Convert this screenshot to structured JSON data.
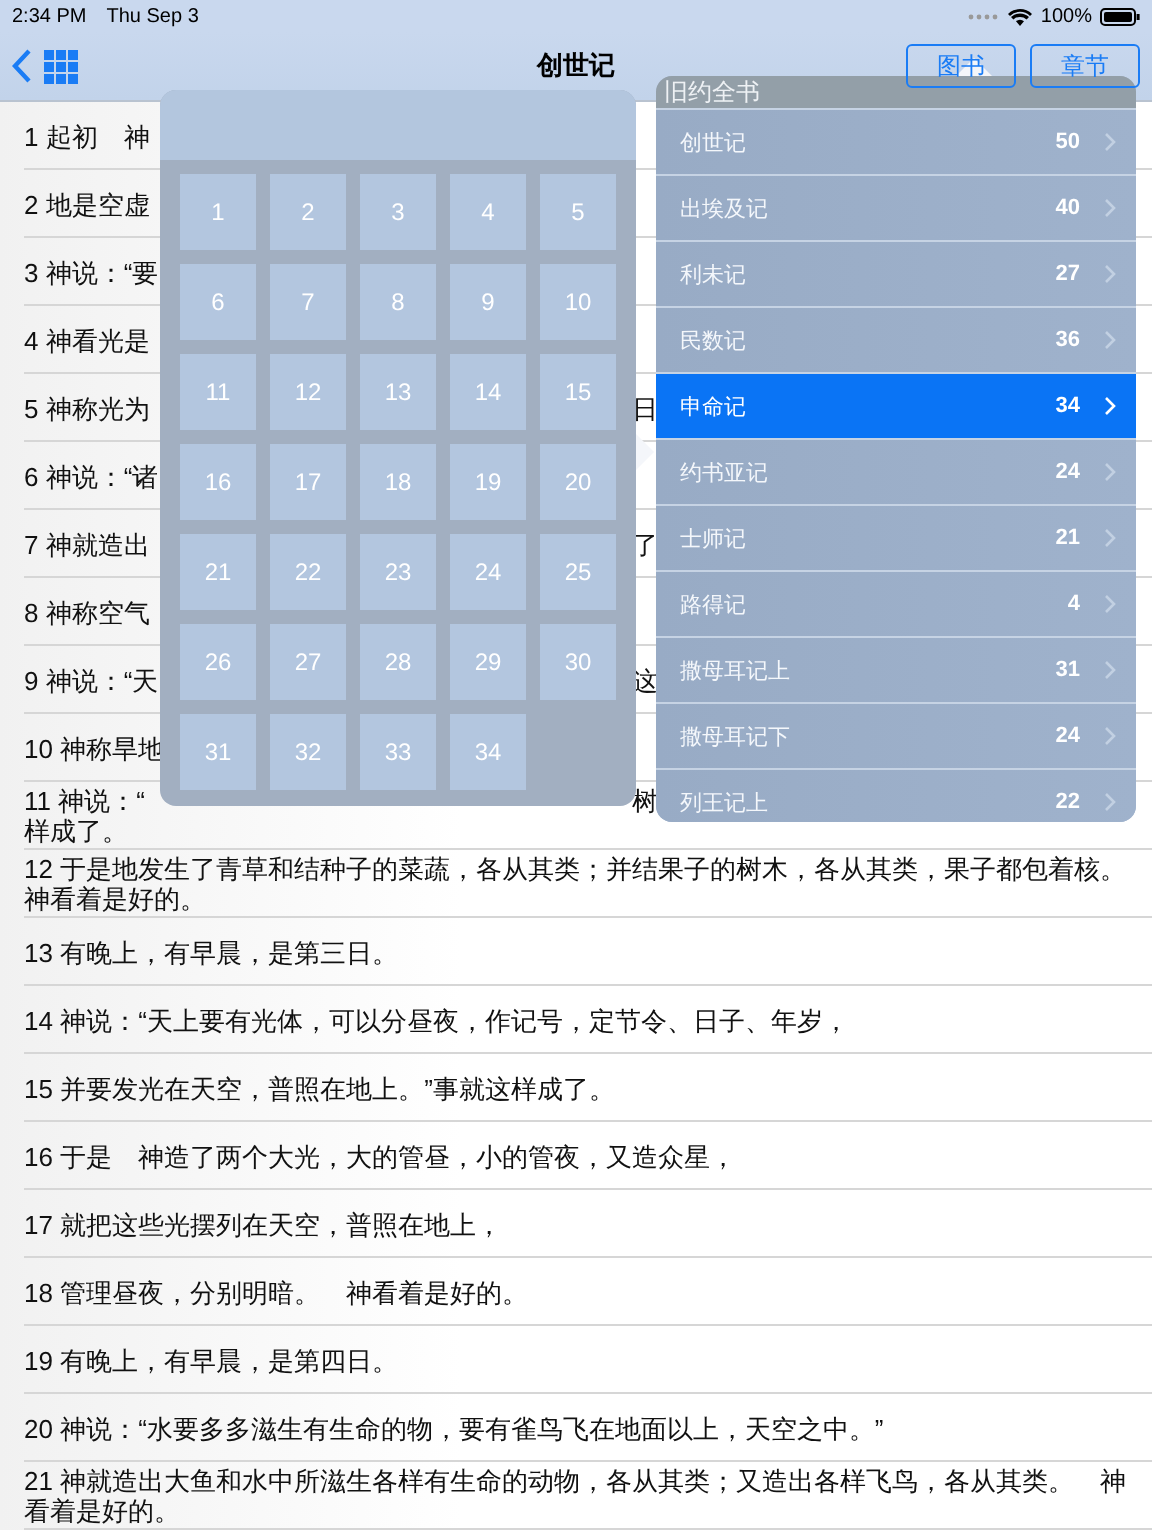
{
  "status_bar": {
    "time": "2:34 PM",
    "date": "Thu Sep 3",
    "battery": "100%"
  },
  "nav": {
    "title": "创世记",
    "buttons": [
      {
        "label": "图书",
        "selected": false
      },
      {
        "label": "章节",
        "selected": false
      }
    ]
  },
  "verses": [
    {
      "text": "1 起初　神"
    },
    {
      "text": "2 地是空虚"
    },
    {
      "text": "3 神说：“要"
    },
    {
      "text": "4 神看光是"
    },
    {
      "text": "5 神称光为",
      "tail": "日"
    },
    {
      "text": "6 神说：“诸"
    },
    {
      "text": "7 神就造出",
      "tail": "了"
    },
    {
      "text": "8 神称空气"
    },
    {
      "text": "9 神说：“天",
      "tail": "这"
    },
    {
      "text": "10 神称旱地"
    },
    {
      "text": "11 神说：“",
      "tail": "树",
      "continuation": "样成了。"
    },
    {
      "text": "12 于是地发生了青草和结种子的菜蔬，各从其类；并结果子的树木，各从其类，果子都包着核。神看着是好的。"
    },
    {
      "text": "13 有晚上，有早晨，是第三日。"
    },
    {
      "text": "14 神说：“天上要有光体，可以分昼夜，作记号，定节令、日子、年岁，"
    },
    {
      "text": "15 并要发光在天空，普照在地上。”事就这样成了。"
    },
    {
      "text": "16 于是　神造了两个大光，大的管昼，小的管夜，又造众星，"
    },
    {
      "text": "17 就把这些光摆列在天空，普照在地上，"
    },
    {
      "text": "18 管理昼夜，分别明暗。　神看着是好的。"
    },
    {
      "text": "19 有晚上，有早晨，是第四日。"
    },
    {
      "text": "20 神说：“水要多多滋生有生命的物，要有雀鸟飞在地面以上，天空之中。”"
    },
    {
      "text": "21 神就造出大鱼和水中所滋生各样有生命的动物，各从其类；又造出各样飞鸟，各从其类。　神看着是好的。"
    }
  ],
  "chapters": [
    "1",
    "2",
    "3",
    "4",
    "5",
    "6",
    "7",
    "8",
    "9",
    "10",
    "11",
    "12",
    "13",
    "14",
    "15",
    "16",
    "17",
    "18",
    "19",
    "20",
    "21",
    "22",
    "23",
    "24",
    "25",
    "26",
    "27",
    "28",
    "29",
    "30",
    "31",
    "32",
    "33",
    "34"
  ],
  "books": {
    "title": "旧约全书",
    "rows": [
      {
        "name": "创世记",
        "count": "50",
        "selected": false
      },
      {
        "name": "出埃及记",
        "count": "40",
        "selected": false
      },
      {
        "name": "利未记",
        "count": "27",
        "selected": false
      },
      {
        "name": "民数记",
        "count": "36",
        "selected": false
      },
      {
        "name": "申命记",
        "count": "34",
        "selected": true
      },
      {
        "name": "约书亚记",
        "count": "24",
        "selected": false
      },
      {
        "name": "士师记",
        "count": "21",
        "selected": false
      },
      {
        "name": "路得记",
        "count": "4",
        "selected": false
      },
      {
        "name": "撒母耳记上",
        "count": "31",
        "selected": false
      },
      {
        "name": "撒母耳记下",
        "count": "24",
        "selected": false
      },
      {
        "name": "列王记上",
        "count": "22",
        "selected": false
      }
    ]
  }
}
